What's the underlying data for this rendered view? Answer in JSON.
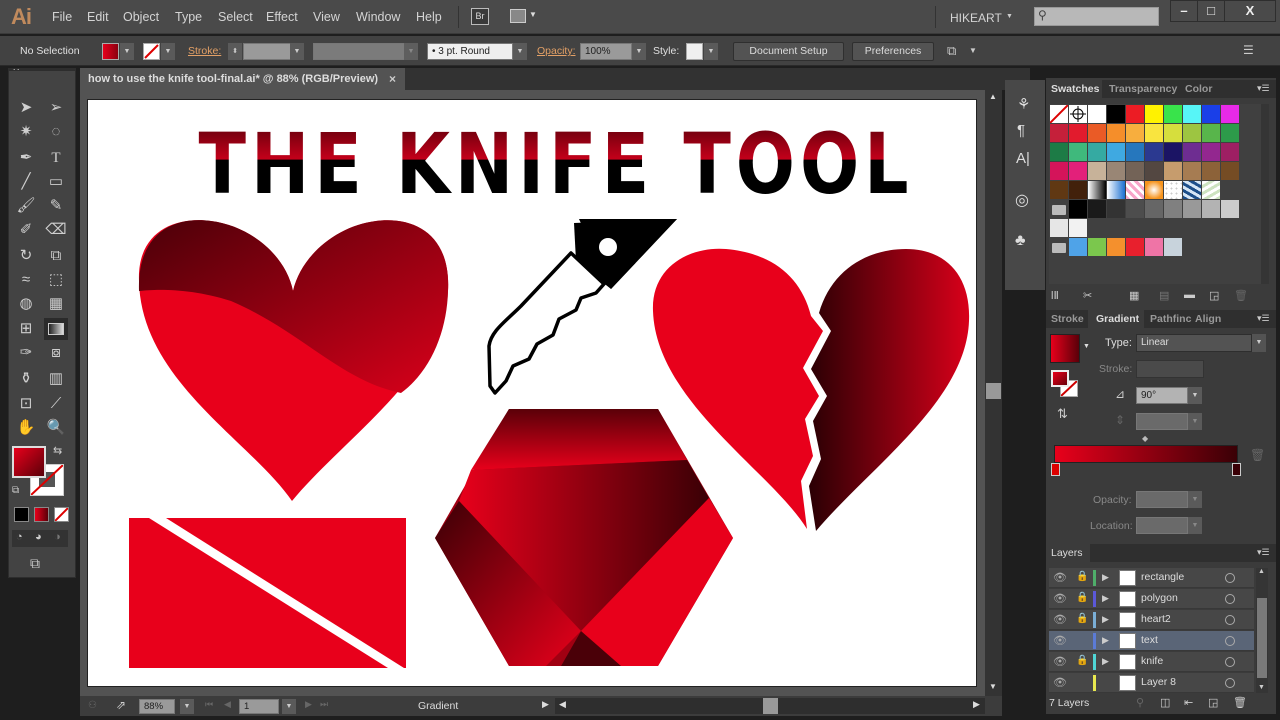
{
  "app": {
    "logo": "Ai",
    "workspace": "HIKEART"
  },
  "menu": {
    "items": [
      "File",
      "Edit",
      "Object",
      "Type",
      "Select",
      "Effect",
      "View",
      "Window",
      "Help"
    ],
    "bridge": "Br"
  },
  "window_controls": {
    "minimize": "–",
    "maximize": "□",
    "close": "X"
  },
  "control_bar": {
    "selection": "No Selection",
    "stroke_label": "Stroke:",
    "brush": "•  3 pt. Round",
    "opacity_label": "Opacity:",
    "opacity_value": "100%",
    "style_label": "Style:",
    "document_setup": "Document Setup",
    "preferences": "Preferences",
    "fill_color": "#c0071a"
  },
  "document": {
    "tab_title": "how to use the knife tool-final.ai* @ 88% (RGB/Preview)",
    "close": "×"
  },
  "artwork": {
    "title": "THE KNIFE TOOL",
    "colors": {
      "bright_red": "#e8001b",
      "dark_red": "#4a0008",
      "black": "#000000"
    }
  },
  "status_bar": {
    "zoom": "88%",
    "artboard": "1",
    "status": "Gradient"
  },
  "swatches_panel": {
    "tabs": [
      "Swatches",
      "Transparency",
      "Color"
    ],
    "rows": [
      [
        "none",
        "registration",
        "#ffffff",
        "#000000",
        "#ec1c24",
        "#fff200",
        "#39e34b",
        "#57f5f7",
        "#1a3fe8",
        "#e82ae8"
      ],
      [
        "#c5203a",
        "#e21b2d",
        "#ea5b26",
        "#f58e2a",
        "#f7ae3e",
        "#f9e43f",
        "#d6de3d",
        "#9dc541",
        "#58b54b",
        "#2d9b4a"
      ],
      [
        "#1d7b46",
        "#3fb97c",
        "#35aaa2",
        "#3fa9e1",
        "#2677bd",
        "#2b3990",
        "#1b1464",
        "#6e2d91",
        "#93278f",
        "#9e1f63"
      ],
      [
        "#d4145a",
        "#e3207a",
        "#c7b299",
        "#998675",
        "#736357",
        "#534741",
        "#c69c6d",
        "#a67c52",
        "#8c6239",
        "#754c24"
      ],
      [
        "#603813",
        "#42210b",
        "grad-bw",
        "grad-blue",
        "pattern-pink",
        "grad-orange",
        "pattern-dots",
        "pattern-blue",
        "pattern-green"
      ],
      [
        "folder",
        "#000000",
        "#1a1a1a",
        "#333333",
        "#4d4d4d",
        "#666666",
        "#808080",
        "#999999",
        "#b3b3b3",
        "#cccccc"
      ],
      [
        "#e6e6e6",
        "#f2f2f2"
      ],
      [
        "folder",
        "#4fa3e8",
        "#7bc74d",
        "#f4902d",
        "#e8202d",
        "#ef74a6",
        "#c8d3dc"
      ]
    ]
  },
  "gradient_panel": {
    "tabs": [
      "Stroke",
      "Gradient",
      "Pathfinc",
      "Align"
    ],
    "type_label": "Type:",
    "type_value": "Linear",
    "stroke_label": "Stroke:",
    "angle_value": "90°",
    "opacity_label": "Opacity:",
    "location_label": "Location:",
    "stop_start": "#e8001b",
    "stop_end": "#3a0006"
  },
  "layers_panel": {
    "title": "Layers",
    "count": "7 Layers",
    "layers": [
      {
        "name": "rectangle",
        "color": "#4fae6a",
        "locked": true,
        "expandable": true
      },
      {
        "name": "polygon",
        "color": "#5b58d8",
        "locked": true,
        "expandable": true
      },
      {
        "name": "heart2",
        "color": "#7aaed6",
        "locked": true,
        "expandable": true
      },
      {
        "name": "text",
        "color": "#5b7bd6",
        "locked": false,
        "expandable": true,
        "selected": true
      },
      {
        "name": "knife",
        "color": "#4fd6d6",
        "locked": true,
        "expandable": true
      },
      {
        "name": "Layer 8",
        "color": "#e8e84f",
        "locked": false,
        "expandable": false
      }
    ]
  }
}
